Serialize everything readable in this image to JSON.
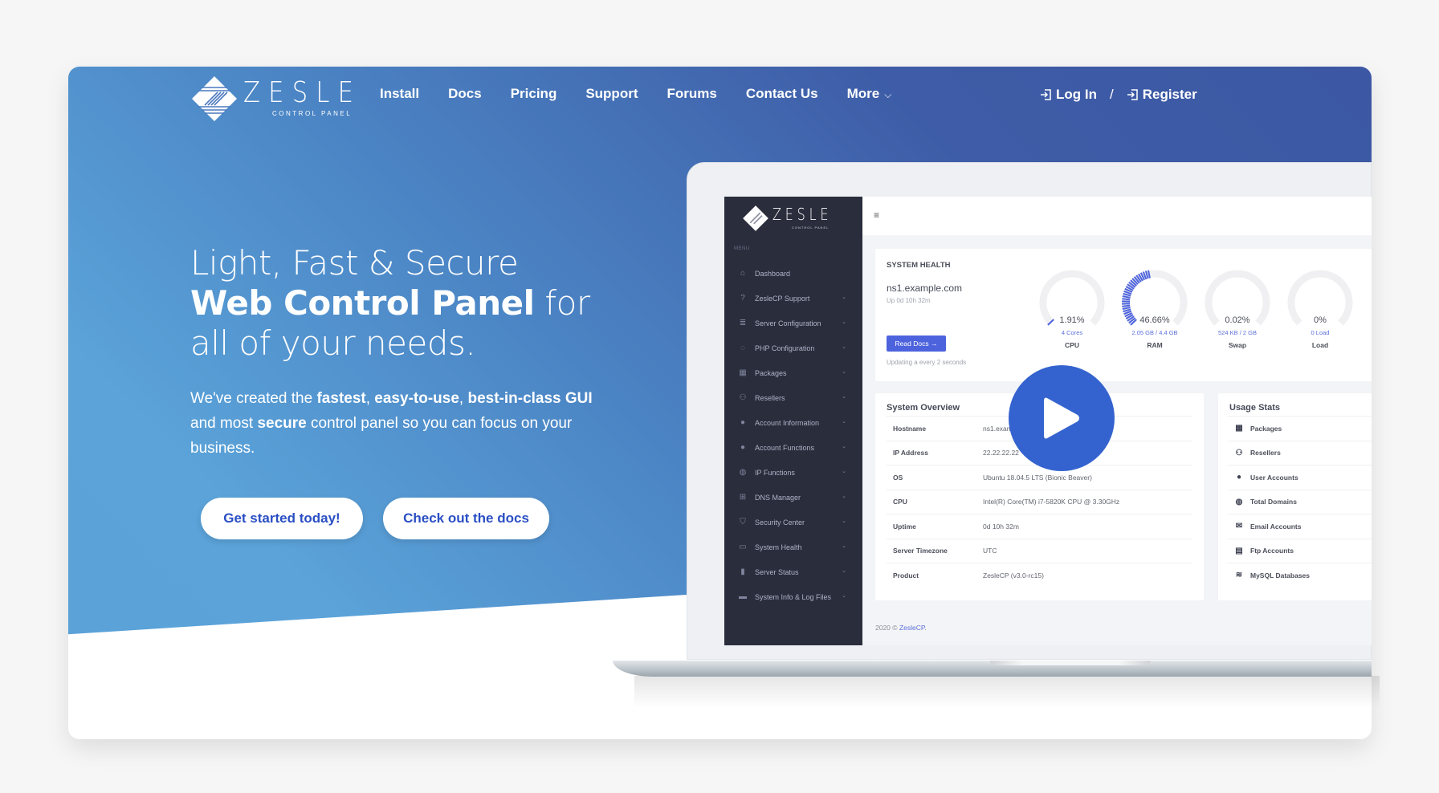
{
  "brand": {
    "name": "ZESLE",
    "subtitle": "CONTROL PANEL"
  },
  "nav": {
    "links": [
      "Install",
      "Docs",
      "Pricing",
      "Support",
      "Forums",
      "Contact Us",
      "More"
    ],
    "login": "Log In",
    "separator": "/",
    "register": "Register"
  },
  "hero": {
    "headline_light_1": "Light, Fast & Secure ",
    "headline_bold_1": "Web Control Panel",
    "headline_light_2": " for all of your needs.",
    "lead": [
      {
        "t": "We've created the ",
        "b": false
      },
      {
        "t": "fastest",
        "b": true
      },
      {
        "t": ", ",
        "b": false
      },
      {
        "t": "easy-to-use",
        "b": true
      },
      {
        "t": ", ",
        "b": false
      },
      {
        "t": "best-in-class GUI",
        "b": true
      },
      {
        "t": " and most ",
        "b": false
      },
      {
        "t": "secure",
        "b": true
      },
      {
        "t": " control panel so you can focus on your business.",
        "b": false
      }
    ],
    "cta_primary": "Get started today!",
    "cta_secondary": "Check out the docs"
  },
  "dashboard": {
    "menu_label": "MENU",
    "sidebar": [
      {
        "label": "Dashboard",
        "icon": "home-icon",
        "glyph": "⌂",
        "chevron": false
      },
      {
        "label": "ZesleCP Support",
        "icon": "help-icon",
        "glyph": "?",
        "chevron": true
      },
      {
        "label": "Server Configuration",
        "icon": "server-icon",
        "glyph": "≣",
        "chevron": true
      },
      {
        "label": "PHP Configuration",
        "icon": "php-icon",
        "glyph": "◌",
        "chevron": true
      },
      {
        "label": "Packages",
        "icon": "package-icon",
        "glyph": "▦",
        "chevron": true
      },
      {
        "label": "Resellers",
        "icon": "users-icon",
        "glyph": "⚇",
        "chevron": true
      },
      {
        "label": "Account Information",
        "icon": "user-icon",
        "glyph": "●",
        "chevron": true
      },
      {
        "label": "Account Functions",
        "icon": "user-cog-icon",
        "glyph": "●",
        "chevron": true
      },
      {
        "label": "IP Functions",
        "icon": "globe-icon",
        "glyph": "◍",
        "chevron": true
      },
      {
        "label": "DNS Manager",
        "icon": "network-icon",
        "glyph": "⊞",
        "chevron": true
      },
      {
        "label": "Security Center",
        "icon": "shield-icon",
        "glyph": "⛉",
        "chevron": true
      },
      {
        "label": "System Health",
        "icon": "monitor-icon",
        "glyph": "▭",
        "chevron": true
      },
      {
        "label": "Server Status",
        "icon": "server-status-icon",
        "glyph": "▮",
        "chevron": true
      },
      {
        "label": "System Info & Log Files",
        "icon": "folder-icon",
        "glyph": "▬",
        "chevron": true
      }
    ],
    "health": {
      "title": "SYSTEM HEALTH",
      "hostname": "ns1.example.com",
      "uptime": "Up 0d 10h 32m",
      "read_docs": "Read Docs →",
      "updating": "Updating a every 2 seconds",
      "gauges": [
        {
          "label": "CPU",
          "value": "1.91%",
          "sub": "4 Cores",
          "percent": 1.91
        },
        {
          "label": "RAM",
          "value": "46.66%",
          "sub": "2.05 GB / 4.4 GB",
          "percent": 46.66
        },
        {
          "label": "Swap",
          "value": "0.02%",
          "sub": "524 KB / 2 GB",
          "percent": 0.02
        },
        {
          "label": "Load",
          "value": "0%",
          "sub": "0 Load",
          "percent": 0
        }
      ]
    },
    "overview": {
      "title": "System Overview",
      "rows": [
        {
          "k": "Hostname",
          "v": "ns1.example.com"
        },
        {
          "k": "IP Address",
          "v": "22.22.22.22"
        },
        {
          "k": "OS",
          "v": "Ubuntu 18.04.5 LTS (Bionic Beaver)"
        },
        {
          "k": "CPU",
          "v": "Intel(R) Core(TM) i7-5820K CPU @ 3.30GHz"
        },
        {
          "k": "Uptime",
          "v": "0d 10h 32m"
        },
        {
          "k": "Server Timezone",
          "v": "UTC"
        },
        {
          "k": "Product",
          "v": "ZesleCP (v3.0-rc15)"
        }
      ]
    },
    "usage": {
      "title": "Usage Stats",
      "rows": [
        {
          "label": "Packages",
          "icon": "package-icon",
          "glyph": "▦"
        },
        {
          "label": "Resellers",
          "icon": "users-icon",
          "glyph": "⚇"
        },
        {
          "label": "User Accounts",
          "icon": "user-icon",
          "glyph": "●"
        },
        {
          "label": "Total Domains",
          "icon": "globe-icon",
          "glyph": "◍"
        },
        {
          "label": "Email Accounts",
          "icon": "mail-icon",
          "glyph": "✉"
        },
        {
          "label": "Ftp Accounts",
          "icon": "file-icon",
          "glyph": "▤"
        },
        {
          "label": "MySQL Databases",
          "icon": "database-icon",
          "glyph": "≋"
        }
      ]
    },
    "footer_year": "2020 © ",
    "footer_link": "ZesleCP."
  },
  "colors": {
    "accent": "#2a4fc4",
    "play": "#3463cf",
    "gauge": "#4d63dd",
    "sidebar": "#2a2d3c"
  }
}
